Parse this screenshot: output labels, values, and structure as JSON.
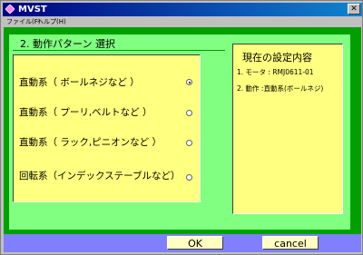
{
  "window": {
    "title": "MVST"
  },
  "menu": {
    "items": [
      "ファイル(F)",
      "ヘルプ(H)"
    ]
  },
  "section": {
    "title": "2. 動作パターン 選択"
  },
  "options": [
    {
      "label": "直動系（ ボールネジなど ）",
      "selected": true
    },
    {
      "label": "直動系（ プーリ,ベルトなど ）",
      "selected": false
    },
    {
      "label": "直動系（ ラック,ピニオンなど ）",
      "selected": false
    },
    {
      "label": "回転系（インデックステーブルなど）",
      "selected": false
    }
  ],
  "settings": {
    "title": "現在の設定内容",
    "lines": [
      "1. モータ : RMJ0611-01",
      "2. 動作 :直動系(ボールネジ)"
    ]
  },
  "buttons": {
    "ok": "OK",
    "cancel": "cancel"
  },
  "colors": {
    "stage": "#00a000",
    "panel": "#80ff80",
    "box": "#ffff80",
    "footer": "#8080ff"
  }
}
